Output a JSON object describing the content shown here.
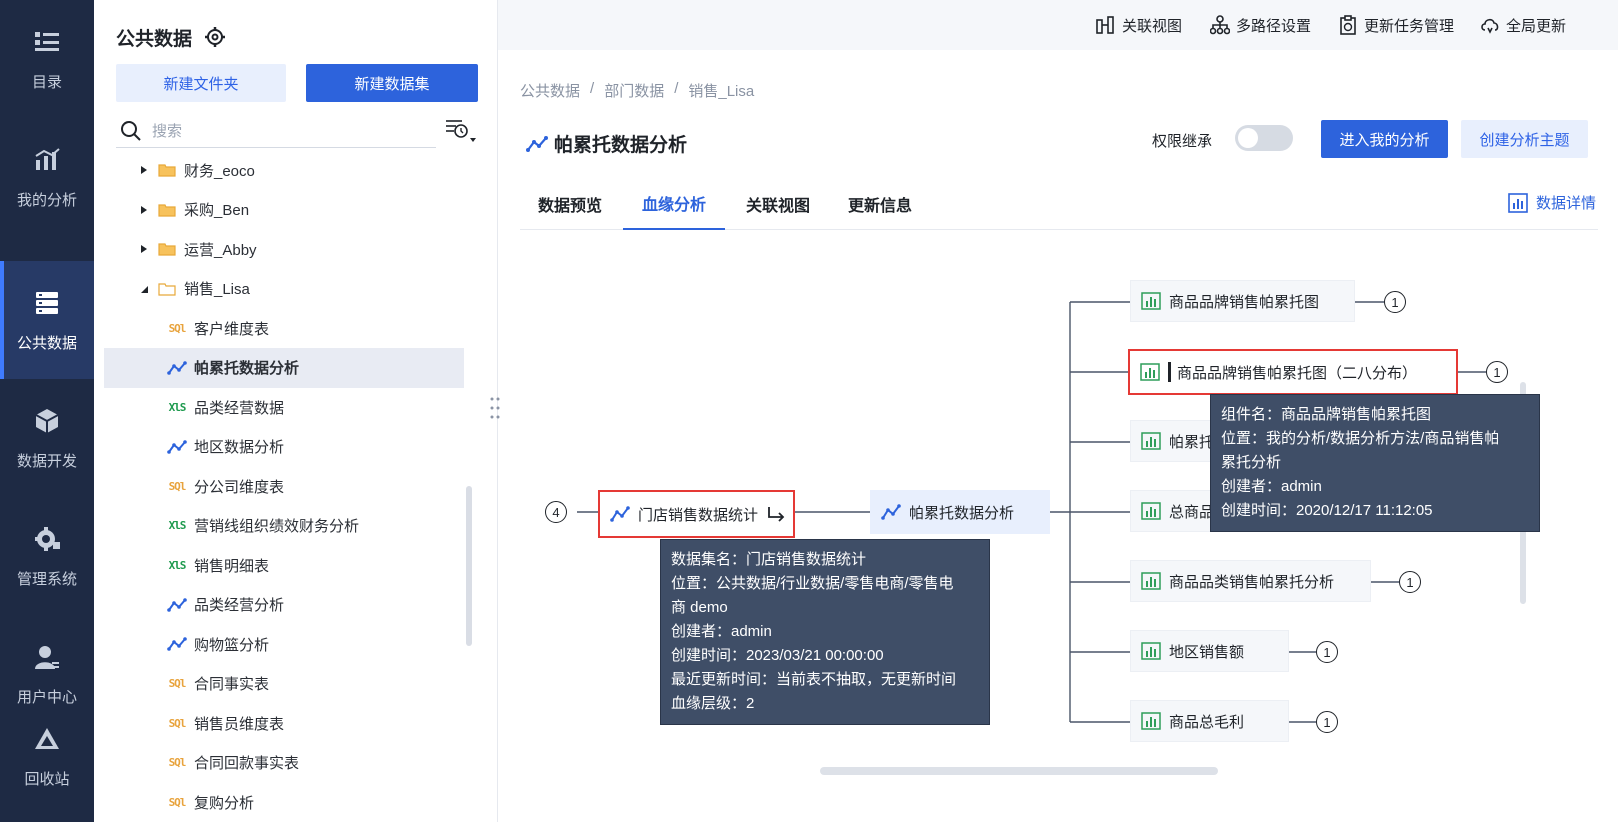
{
  "rail": {
    "items": [
      {
        "label": "目录",
        "icon": "catalog-icon"
      },
      {
        "label": "我的分析",
        "icon": "chart-icon"
      },
      {
        "label": "公共数据",
        "icon": "database-icon"
      },
      {
        "label": "数据开发",
        "icon": "cube-icon"
      },
      {
        "label": "管理系统",
        "icon": "gear-icon"
      },
      {
        "label": "用户中心",
        "icon": "user-icon"
      },
      {
        "label": "回收站",
        "icon": "recycle-icon"
      }
    ]
  },
  "sidebar": {
    "title": "公共数据",
    "new_folder": "新建文件夹",
    "new_dataset": "新建数据集",
    "search_placeholder": "搜索",
    "tree": [
      {
        "label": "财务_eoco",
        "type": "folder"
      },
      {
        "label": "采购_Ben",
        "type": "folder"
      },
      {
        "label": "运营_Abby",
        "type": "folder"
      },
      {
        "label": "销售_Lisa",
        "type": "folder-open"
      },
      {
        "label": "客户维度表",
        "type": "sql"
      },
      {
        "label": "帕累托数据分析",
        "type": "analysis"
      },
      {
        "label": "品类经营数据",
        "type": "xls"
      },
      {
        "label": "地区数据分析",
        "type": "analysis"
      },
      {
        "label": "分公司维度表",
        "type": "sql"
      },
      {
        "label": "营销线组织绩效财务分析",
        "type": "xls"
      },
      {
        "label": "销售明细表",
        "type": "xls"
      },
      {
        "label": "品类经营分析",
        "type": "analysis"
      },
      {
        "label": "购物篮分析",
        "type": "analysis"
      },
      {
        "label": "合同事实表",
        "type": "sql"
      },
      {
        "label": "销售员维度表",
        "type": "sql"
      },
      {
        "label": "合同回款事实表",
        "type": "sql"
      },
      {
        "label": "复购分析",
        "type": "sql"
      }
    ]
  },
  "topbar": {
    "items": [
      "关联视图",
      "多路径设置",
      "更新任务管理",
      "全局更新"
    ]
  },
  "breadcrumb": [
    "公共数据",
    "部门数据",
    "销售_Lisa"
  ],
  "breadcrumb_sep": "/",
  "page": {
    "title": "帕累托数据分析",
    "perm_label": "权限继承",
    "enter_btn": "进入我的分析",
    "create_btn": "创建分析主题",
    "tabs": [
      "数据预览",
      "血缘分析",
      "关联视图",
      "更新信息"
    ],
    "data_detail": "数据详情"
  },
  "lineage": {
    "upstream_count": "4",
    "source_node": "门店销售数据统计",
    "center_node": "帕累托数据分析",
    "children": [
      {
        "label": "商品品牌销售帕累托图",
        "count": "1"
      },
      {
        "label": "商品品牌销售帕累托图（二八分布）",
        "count": "1"
      },
      {
        "label": "帕累托",
        "count": ""
      },
      {
        "label": "总商品",
        "count": ""
      },
      {
        "label": "商品品类销售帕累托分析",
        "count": "1"
      },
      {
        "label": "地区销售额",
        "count": "1"
      },
      {
        "label": "商品总毛利",
        "count": "1"
      }
    ],
    "tip_dataset": [
      "数据集名：门店销售数据统计",
      "位置：公共数据/行业数据/零售电商/零售电",
      "商 demo",
      "创建者：admin",
      "创建时间：2023/03/21 00:00:00",
      "最近更新时间：当前表不抽取，无更新时间",
      "血缘层级：2"
    ],
    "tip_component": [
      "组件名：商品品牌销售帕累托图",
      "位置：我的分析/数据分析方法/商品销售帕",
      "累托分析",
      "创建者：admin",
      "创建时间：2020/12/17 11:12:05"
    ]
  },
  "colors": {
    "accent": "#2d63dc",
    "rail": "#1e2a44",
    "highlight": "#e53935",
    "tooltip": "#3f4e67"
  }
}
